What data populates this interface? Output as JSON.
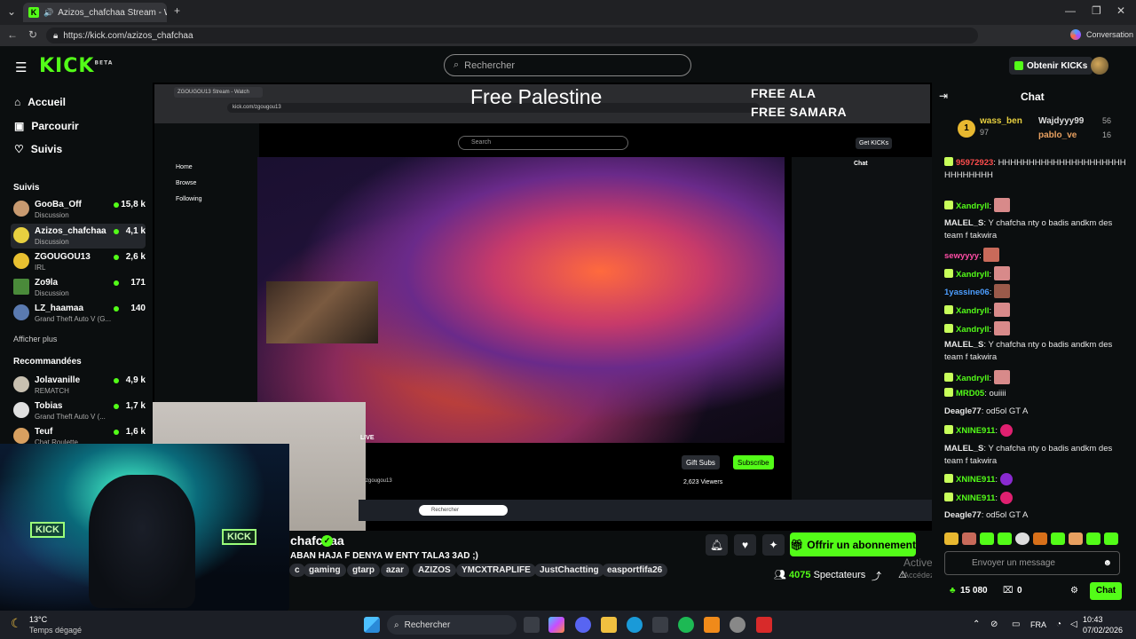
{
  "browser": {
    "tab_title": "Azizos_chafchaa Stream - Wa",
    "url": "https://kick.com/azizos_chafchaa",
    "conversation": "Conversation",
    "add_tab": "+"
  },
  "header": {
    "logo": "KICK",
    "beta": "BETA",
    "search_placeholder": "Rechercher",
    "get_kicks": "Obtenir KICKs"
  },
  "sidebar": {
    "nav": [
      {
        "label": "Accueil",
        "icon": "home-icon"
      },
      {
        "label": "Parcourir",
        "icon": "browse-icon"
      },
      {
        "label": "Suivis",
        "icon": "heart-icon"
      }
    ],
    "following_title": "Suivis",
    "following": [
      {
        "name": "GooBa_Off",
        "sub": "Discussion",
        "viewers": "15,8 k"
      },
      {
        "name": "Azizos_chafchaa",
        "sub": "Discussion",
        "viewers": "4,1 k"
      },
      {
        "name": "ZGOUGOU13",
        "sub": "IRL",
        "viewers": "2,6 k"
      },
      {
        "name": "Zo9la",
        "sub": "Discussion",
        "viewers": "171"
      },
      {
        "name": "LZ_haamaa",
        "sub": "Grand Theft Auto V (G...",
        "viewers": "140"
      }
    ],
    "show_more": "Afficher plus",
    "recommended_title": "Recommandées",
    "recommended": [
      {
        "name": "Jolavanille",
        "sub": "REMATCH",
        "viewers": "4,9 k"
      },
      {
        "name": "Tobias",
        "sub": "Grand Theft Auto V (...",
        "viewers": "1,7 k"
      },
      {
        "name": "Teuf",
        "sub": "Chat Roulette",
        "viewers": "1,6 k"
      }
    ]
  },
  "overlay": {
    "title": "Free Palestine",
    "free1": "FREE ALA",
    "free2": "FREE SAMARA"
  },
  "inner": {
    "url": "kick.com/zgougou13",
    "search": "Search",
    "get_kicks": "Get KICKs",
    "chat": "Chat",
    "home": "Home",
    "browse": "Browse",
    "following": "Following",
    "gift": "Gift Subs",
    "subscribe": "Subscribe",
    "viewers": "2,623 Viewers",
    "taskbar_search": "Rechercher",
    "live": "LIVE",
    "streamer": "zgougou13"
  },
  "stream": {
    "channel_name": "chafchaa",
    "title": "ABAN HAJA F DENYA W ENTY TALA3 3AD ;)",
    "tags": [
      "c",
      "gaming",
      "gtarp",
      "azar",
      "AZIZOS",
      "YMCXTRAPLIFE",
      "JustChactting",
      "easportfifa26"
    ],
    "subscribe": "Offrir un abonnement",
    "viewers_count": "4075",
    "viewers_label": "Spectateurs",
    "watermark1": "Activer Windows",
    "watermark2": "Accédez aux paramètres pour activer Windows."
  },
  "chat": {
    "title": "Chat",
    "pinned": [
      {
        "name": "wass_ben",
        "count": "97"
      },
      {
        "name": "Wajdyyy99",
        "count": "56"
      },
      {
        "name": "pablo_ve",
        "count": "16"
      }
    ],
    "messages": [
      {
        "user": "95972923",
        "text": "HHHHHHHHHHHHHHHHHHHHHHHHHHHHH",
        "color": "#ff4d4d"
      },
      {
        "user": "Xandryll",
        "text": "",
        "color": "#53fc18"
      },
      {
        "user": "MALEL_S",
        "text": "Y chafcha nty o badis andkm des team f takwira",
        "color": "#e8e8e8"
      },
      {
        "user": "sewyyyy",
        "text": "",
        "color": "#ff4da6"
      },
      {
        "user": "Xandryll",
        "text": "",
        "color": "#53fc18"
      },
      {
        "user": "1yassine06",
        "text": "",
        "color": "#4d9eff"
      },
      {
        "user": "Xandryll",
        "text": "",
        "color": "#53fc18"
      },
      {
        "user": "Xandryll",
        "text": "",
        "color": "#53fc18"
      },
      {
        "user": "MALEL_S",
        "text": "Y chafcha nty o badis andkm des team f takwira",
        "color": "#e8e8e8"
      },
      {
        "user": "Xandryll",
        "text": "",
        "color": "#53fc18"
      },
      {
        "user": "MRD05",
        "text": "ouiiii",
        "color": "#53fc18"
      },
      {
        "user": "Deagle77",
        "text": "od5ol GT A",
        "color": "#e8e8e8"
      },
      {
        "user": "XNINE911",
        "text": "",
        "color": "#53fc18"
      },
      {
        "user": "MALEL_S",
        "text": "Y chafcha nty o badis andkm des team f takwira",
        "color": "#e8e8e8"
      },
      {
        "user": "XNINE911",
        "text": "",
        "color": "#53fc18"
      },
      {
        "user": "XNINE911",
        "text": "",
        "color": "#53fc18"
      },
      {
        "user": "Deagle77",
        "text": "od5ol GT A",
        "color": "#e8e8e8"
      }
    ],
    "input_placeholder": "Envoyer un message",
    "kicks": "15 080",
    "zero": "0",
    "send": "Chat"
  },
  "taskbar": {
    "weather_temp": "13°C",
    "weather_desc": "Temps dégagé",
    "search": "Rechercher",
    "lang": "FRA",
    "time": "10:43",
    "date": "07/02/2026"
  }
}
